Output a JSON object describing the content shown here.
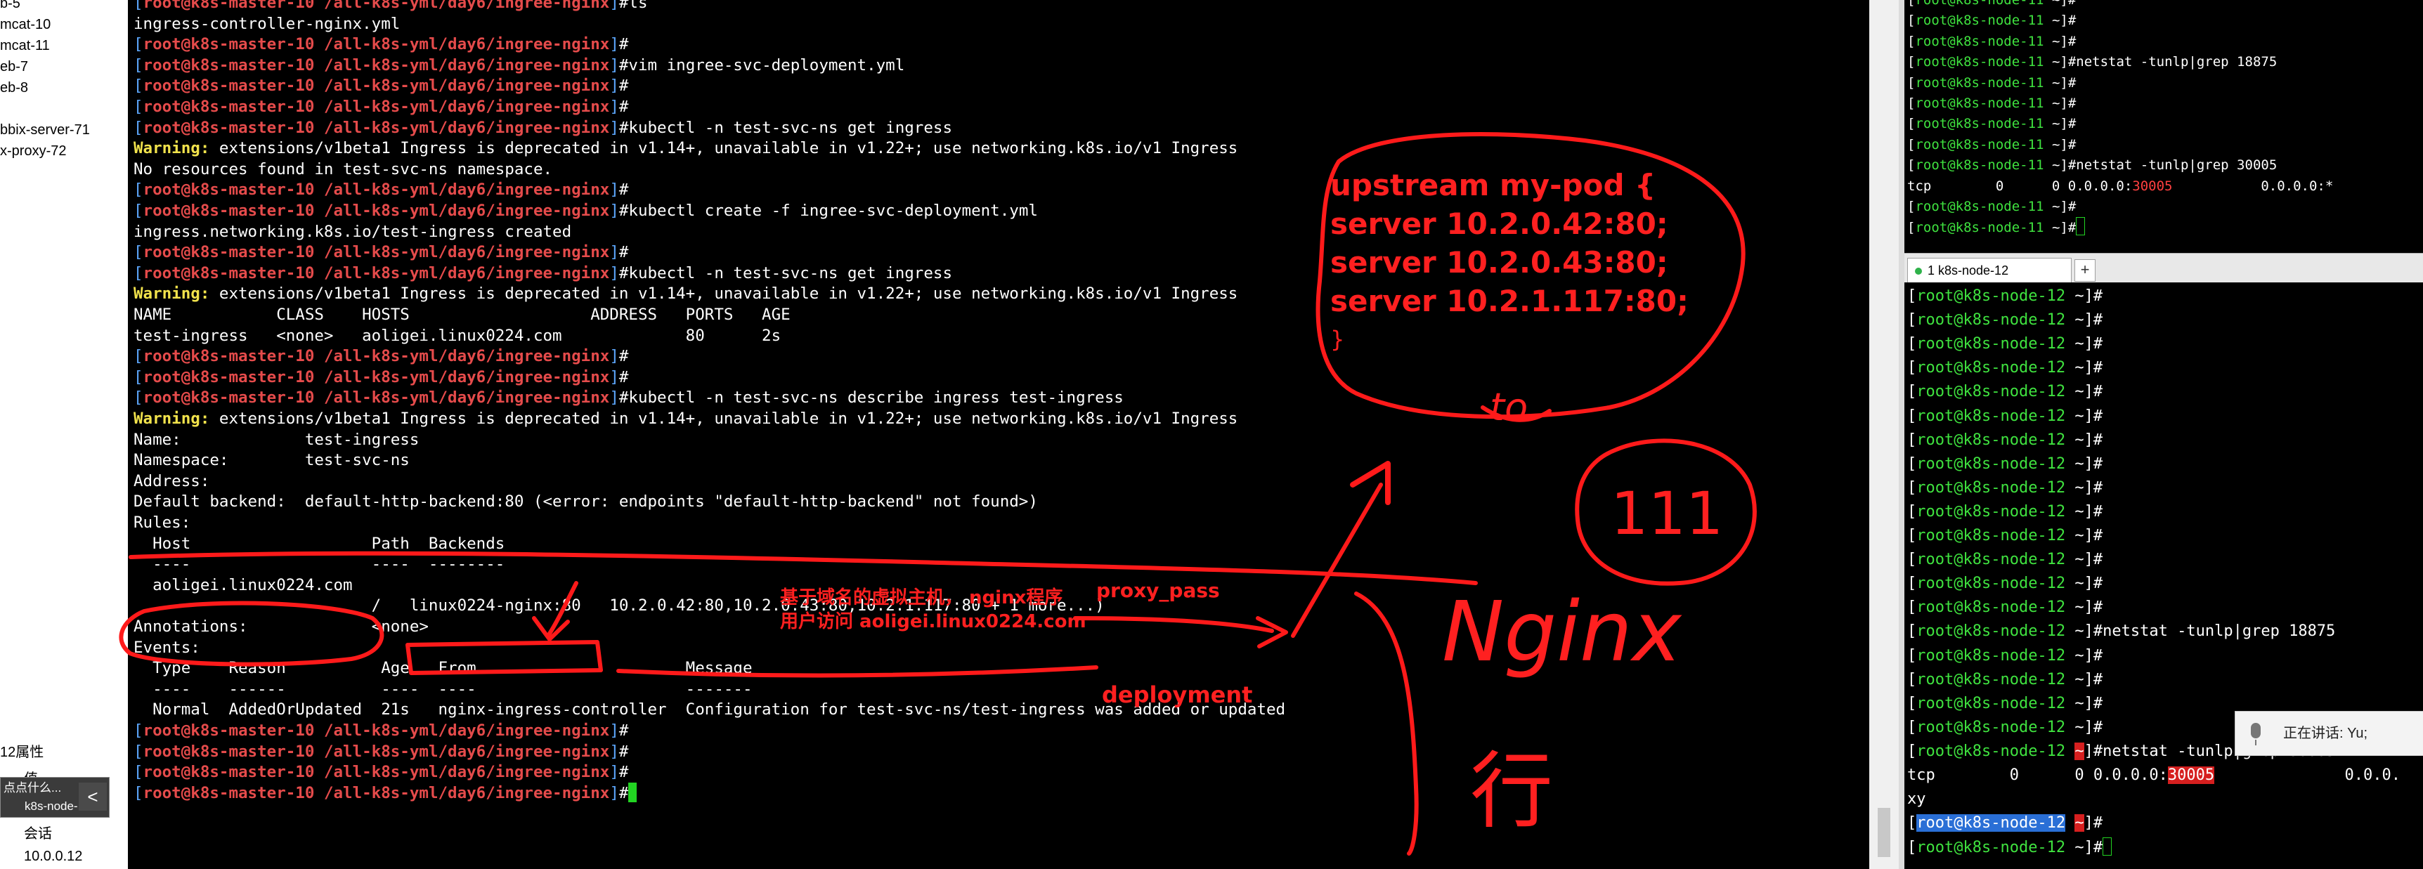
{
  "sidebar": {
    "items": [
      "b-5",
      "mcat-10",
      "mcat-11",
      "eb-7",
      "eb-8",
      "",
      "bbix-server-71",
      "x-proxy-72"
    ],
    "properties_header": "12属性",
    "prop_rows": [
      "值",
      "会话",
      "10.0.0.12"
    ],
    "tooltip_lines": [
      "点点什么...",
      "k8s-node-..."
    ],
    "collapse_label": "<"
  },
  "main_terminal": {
    "prompt_user": "root@k8s-master-10",
    "prompt_path": "/all-k8s-yml/day6/ingree-nginx",
    "warning_label": "Warning:",
    "warning_text": " extensions/v1beta1 Ingress is deprecated in v1.14+, unavailable in v1.22+; use networking.k8s.io/v1 Ingress",
    "lines": [
      {
        "kind": "prompt",
        "cmd": "ls"
      },
      {
        "kind": "out",
        "text": "ingress-controller-nginx.yml"
      },
      {
        "kind": "prompt",
        "cmd": ""
      },
      {
        "kind": "prompt",
        "cmd": "vim ingree-svc-deployment.yml"
      },
      {
        "kind": "prompt",
        "cmd": ""
      },
      {
        "kind": "prompt",
        "cmd": ""
      },
      {
        "kind": "prompt",
        "cmd": "kubectl -n test-svc-ns get ingress"
      },
      {
        "kind": "warn"
      },
      {
        "kind": "out",
        "text": "No resources found in test-svc-ns namespace."
      },
      {
        "kind": "prompt",
        "cmd": ""
      },
      {
        "kind": "prompt",
        "cmd": "kubectl create -f ingree-svc-deployment.yml"
      },
      {
        "kind": "out",
        "text": "ingress.networking.k8s.io/test-ingress created"
      },
      {
        "kind": "prompt",
        "cmd": ""
      },
      {
        "kind": "prompt",
        "cmd": "kubectl -n test-svc-ns get ingress"
      },
      {
        "kind": "warn"
      },
      {
        "kind": "out",
        "text": "NAME           CLASS    HOSTS                   ADDRESS   PORTS   AGE"
      },
      {
        "kind": "out",
        "text": "test-ingress   <none>   aoligei.linux0224.com             80      2s"
      },
      {
        "kind": "prompt",
        "cmd": ""
      },
      {
        "kind": "prompt",
        "cmd": ""
      },
      {
        "kind": "prompt",
        "cmd": "kubectl -n test-svc-ns describe ingress test-ingress"
      },
      {
        "kind": "warn"
      },
      {
        "kind": "out",
        "text": "Name:             test-ingress"
      },
      {
        "kind": "out",
        "text": "Namespace:        test-svc-ns"
      },
      {
        "kind": "out",
        "text": "Address:"
      },
      {
        "kind": "out",
        "text": "Default backend:  default-http-backend:80 (<error: endpoints \"default-http-backend\" not found>)"
      },
      {
        "kind": "out",
        "text": "Rules:"
      },
      {
        "kind": "out",
        "text": "  Host                   Path  Backends"
      },
      {
        "kind": "out",
        "text": "  ----                   ----  --------"
      },
      {
        "kind": "out",
        "text": "  aoligei.linux0224.com"
      },
      {
        "kind": "out",
        "text": "                         /   linux0224-nginx:80   10.2.0.42:80,10.2.0.43:80,10.2.1.117:80 + 1 more...)"
      },
      {
        "kind": "out",
        "text": "Annotations:             <none>"
      },
      {
        "kind": "out",
        "text": "Events:"
      },
      {
        "kind": "out",
        "text": "  Type    Reason          Age   From                      Message"
      },
      {
        "kind": "out",
        "text": "  ----    ------          ----  ----                      -------"
      },
      {
        "kind": "out",
        "text": "  Normal  AddedOrUpdated  21s   nginx-ingress-controller  Configuration for test-svc-ns/test-ingress was added or updated"
      },
      {
        "kind": "prompt",
        "cmd": ""
      },
      {
        "kind": "prompt",
        "cmd": ""
      },
      {
        "kind": "prompt",
        "cmd": ""
      },
      {
        "kind": "prompt_cursor",
        "cmd": ""
      }
    ]
  },
  "top_right_terminal": {
    "prompt_user": "root@k8s-node-11",
    "prompt_dir": "~",
    "lines": [
      {
        "kind": "prompt",
        "cmd": ""
      },
      {
        "kind": "prompt",
        "cmd": ""
      },
      {
        "kind": "prompt",
        "cmd": ""
      },
      {
        "kind": "prompt",
        "cmd": "netstat -tunlp|grep 18875"
      },
      {
        "kind": "prompt",
        "cmd": ""
      },
      {
        "kind": "prompt",
        "cmd": ""
      },
      {
        "kind": "prompt",
        "cmd": ""
      },
      {
        "kind": "prompt",
        "cmd": ""
      },
      {
        "kind": "prompt",
        "cmd": "netstat -tunlp|grep 30005"
      },
      {
        "kind": "tcp",
        "pre": "tcp        0      0 0.0.0.0:",
        "port": "30005",
        "post": "           0.0.0.0:*"
      },
      {
        "kind": "prompt",
        "cmd": ""
      },
      {
        "kind": "prompt_cursor",
        "cmd": ""
      }
    ]
  },
  "tab": {
    "label": "1 k8s-node-12",
    "add": "+"
  },
  "bottom_right_terminal": {
    "prompt_user": "root@k8s-node-12",
    "prompt_dir": "~",
    "lines": [
      {
        "kind": "prompt",
        "cmd": ""
      },
      {
        "kind": "prompt",
        "cmd": ""
      },
      {
        "kind": "prompt",
        "cmd": ""
      },
      {
        "kind": "prompt",
        "cmd": ""
      },
      {
        "kind": "prompt",
        "cmd": ""
      },
      {
        "kind": "prompt",
        "cmd": ""
      },
      {
        "kind": "prompt",
        "cmd": ""
      },
      {
        "kind": "prompt",
        "cmd": ""
      },
      {
        "kind": "prompt",
        "cmd": ""
      },
      {
        "kind": "prompt",
        "cmd": ""
      },
      {
        "kind": "prompt",
        "cmd": ""
      },
      {
        "kind": "prompt",
        "cmd": ""
      },
      {
        "kind": "prompt",
        "cmd": ""
      },
      {
        "kind": "prompt",
        "cmd": ""
      },
      {
        "kind": "prompt",
        "cmd": "netstat -tunlp|grep 18875"
      },
      {
        "kind": "prompt",
        "cmd": ""
      },
      {
        "kind": "prompt",
        "cmd": ""
      },
      {
        "kind": "prompt",
        "cmd": ""
      },
      {
        "kind": "prompt",
        "cmd": ""
      },
      {
        "kind": "hl_prompt",
        "cmd": "netstat -tunlp|grep 30005"
      },
      {
        "kind": "tcp",
        "pre": "tcp        0      0 0.0.0.0:",
        "port": "30005",
        "post": "              0.0.0."
      },
      {
        "kind": "out",
        "text": "xy"
      },
      {
        "kind": "hl_prompt2",
        "cmd": ""
      },
      {
        "kind": "prompt_cursor",
        "cmd": ""
      }
    ]
  },
  "voice_popup": {
    "text": "正在讲话: Yu;"
  },
  "annotations": {
    "upstream": [
      "upstream my-pod {",
      "server 10.2.0.42:80;",
      "server 10.2.0.43:80;",
      "server 10.2.1.117:80;",
      "}"
    ],
    "vhost_line1": "基于域名的虚拟主机， nginx程序",
    "vhost_line2": "用户访问 aoligei.linux0224.com",
    "proxy_pass": "proxy_pass",
    "deployment": "deployment",
    "handwritten": [
      "to",
      "111",
      "Nginx",
      "行"
    ]
  }
}
